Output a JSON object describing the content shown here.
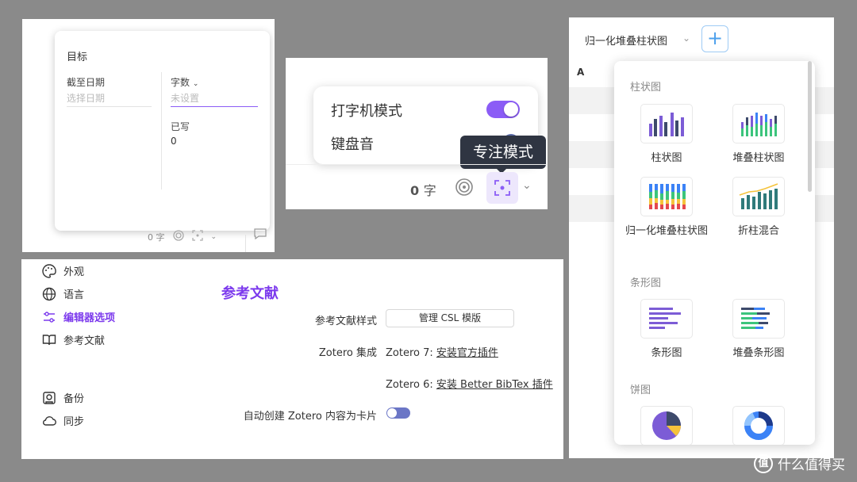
{
  "goal": {
    "title": "目标",
    "deadline_label": "截至日期",
    "deadline_placeholder": "选择日期",
    "metric_label": "字数",
    "metric_value": "未设置",
    "written_label": "已写",
    "written_value": "0",
    "footer_count": "0 字"
  },
  "typewriter": {
    "typewriter_label": "打字机模式",
    "typewriter_on": true,
    "keyboard_label": "键盘音",
    "tooltip": "专注模式",
    "count_num": "0",
    "count_unit": "字"
  },
  "settings": {
    "nav": [
      {
        "label": "外观"
      },
      {
        "label": "语言"
      },
      {
        "label": "编辑器选项"
      },
      {
        "label": "参考文献"
      },
      {
        "label": "备份"
      },
      {
        "label": "同步"
      }
    ],
    "section_title": "参考文献",
    "csl_label": "参考文献样式",
    "csl_button": "管理 CSL 模版",
    "zotero_label": "Zotero 集成",
    "zotero7_prefix": "Zotero 7: ",
    "zotero7_link": "安装官方插件",
    "zotero6_prefix": "Zotero 6: ",
    "zotero6_link": "安装 Better BibTex 插件",
    "auto_label": "自动创建 Zotero 内容为卡片"
  },
  "chart_picker": {
    "current": "归一化堆叠柱状图",
    "column_a": "A",
    "groups": [
      {
        "title": "柱状图",
        "items": [
          {
            "label": "柱状图"
          },
          {
            "label": "堆叠柱状图"
          },
          {
            "label": "归一化堆叠柱状图"
          },
          {
            "label": "折柱混合"
          }
        ]
      },
      {
        "title": "条形图",
        "items": [
          {
            "label": "条形图"
          },
          {
            "label": "堆叠条形图"
          }
        ]
      },
      {
        "title": "饼图",
        "items": []
      }
    ],
    "colors": {
      "purple": "#7c5cd6",
      "navy": "#3d4a6b",
      "green": "#3cc47c",
      "blue": "#3b82f6",
      "red": "#e5484d",
      "yellow": "#f5c33b",
      "teal": "#2f7a7a"
    }
  },
  "watermark": "什么值得买"
}
